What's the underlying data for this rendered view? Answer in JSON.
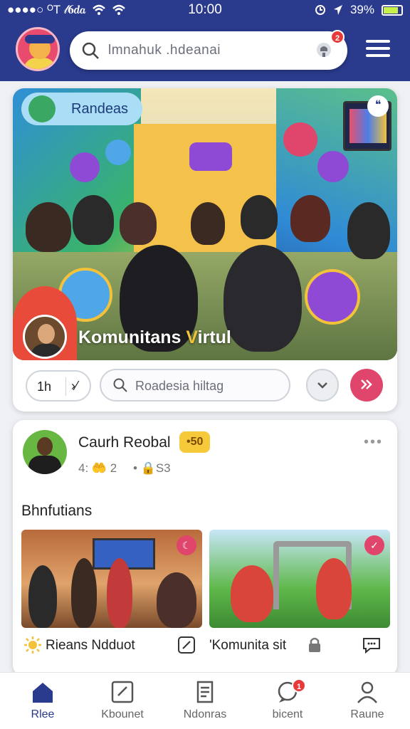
{
  "status_bar": {
    "carrier": "●●●●○ ᴼT 𝓁𝟔𝒅𝒂",
    "time": "10:00",
    "battery": "39%"
  },
  "header": {
    "search_text": "lmnahuk .hdeanai",
    "notification_count": "2"
  },
  "hero": {
    "label": "Randeas",
    "title_main": "Komunitans ",
    "title_accent": "V",
    "title_rest": "irtul",
    "stats_left": "1h",
    "stats_right": "›⁄",
    "search_text": "Roadesia hiltag"
  },
  "post": {
    "author": "Caurh Reobal",
    "tag": "•50",
    "meta_left": "4: 🤲 2",
    "meta_right": "• 🔒S3",
    "section_title": "Bhnfutians",
    "tiles": [
      {
        "caption": "Rieans Ndduot"
      },
      {
        "caption": "'Komunita sit"
      }
    ]
  },
  "bottom_nav": {
    "items": [
      {
        "label": "Rlee"
      },
      {
        "label": "Kbounet"
      },
      {
        "label": "Ndonras"
      },
      {
        "label": "bicent",
        "badge": "1"
      },
      {
        "label": "Raune"
      }
    ]
  },
  "colors": {
    "brand": "#2a3a8c",
    "accent": "#e0456b",
    "tag": "#f5c93a"
  }
}
